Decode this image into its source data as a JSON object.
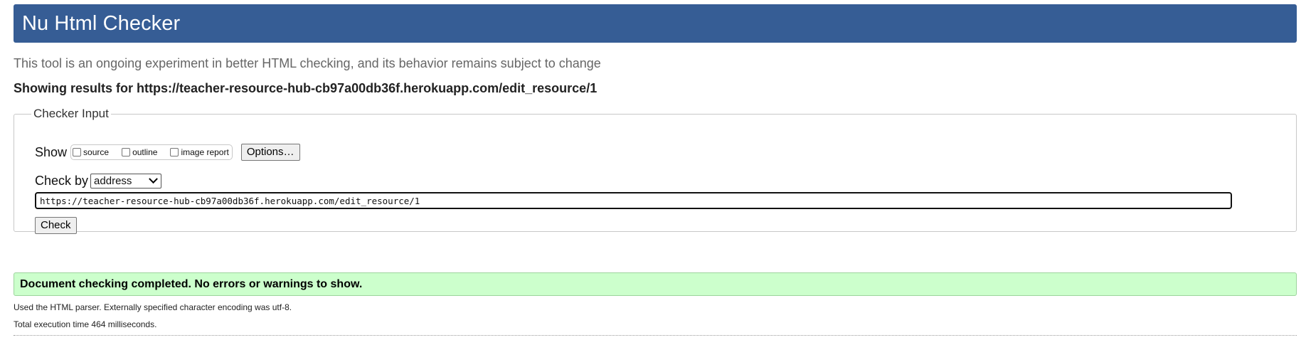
{
  "header": {
    "title": "Nu Html Checker"
  },
  "tagline": "This tool is an ongoing experiment in better HTML checking, and its behavior remains subject to change",
  "showing_results": "Showing results for https://teacher-resource-hub-cb97a00db36f.herokuapp.com/edit_resource/1",
  "checker_input": {
    "legend": "Checker Input",
    "show_label": "Show",
    "show_options": {
      "source": "source",
      "outline": "outline",
      "image_report": "image report"
    },
    "options_button": "Options…",
    "check_by_label": "Check by",
    "check_by_selected": "address",
    "url_value": "https://teacher-resource-hub-cb97a00db36f.herokuapp.com/edit_resource/1",
    "check_button": "Check"
  },
  "result": {
    "success_message": "Document checking completed. No errors or warnings to show.",
    "parser_info": "Used the HTML parser. Externally specified character encoding was utf-8.",
    "execution_time": "Total execution time 464 milliseconds."
  },
  "colors": {
    "header_bg": "#365d95",
    "success_bg": "#ccffcc"
  }
}
